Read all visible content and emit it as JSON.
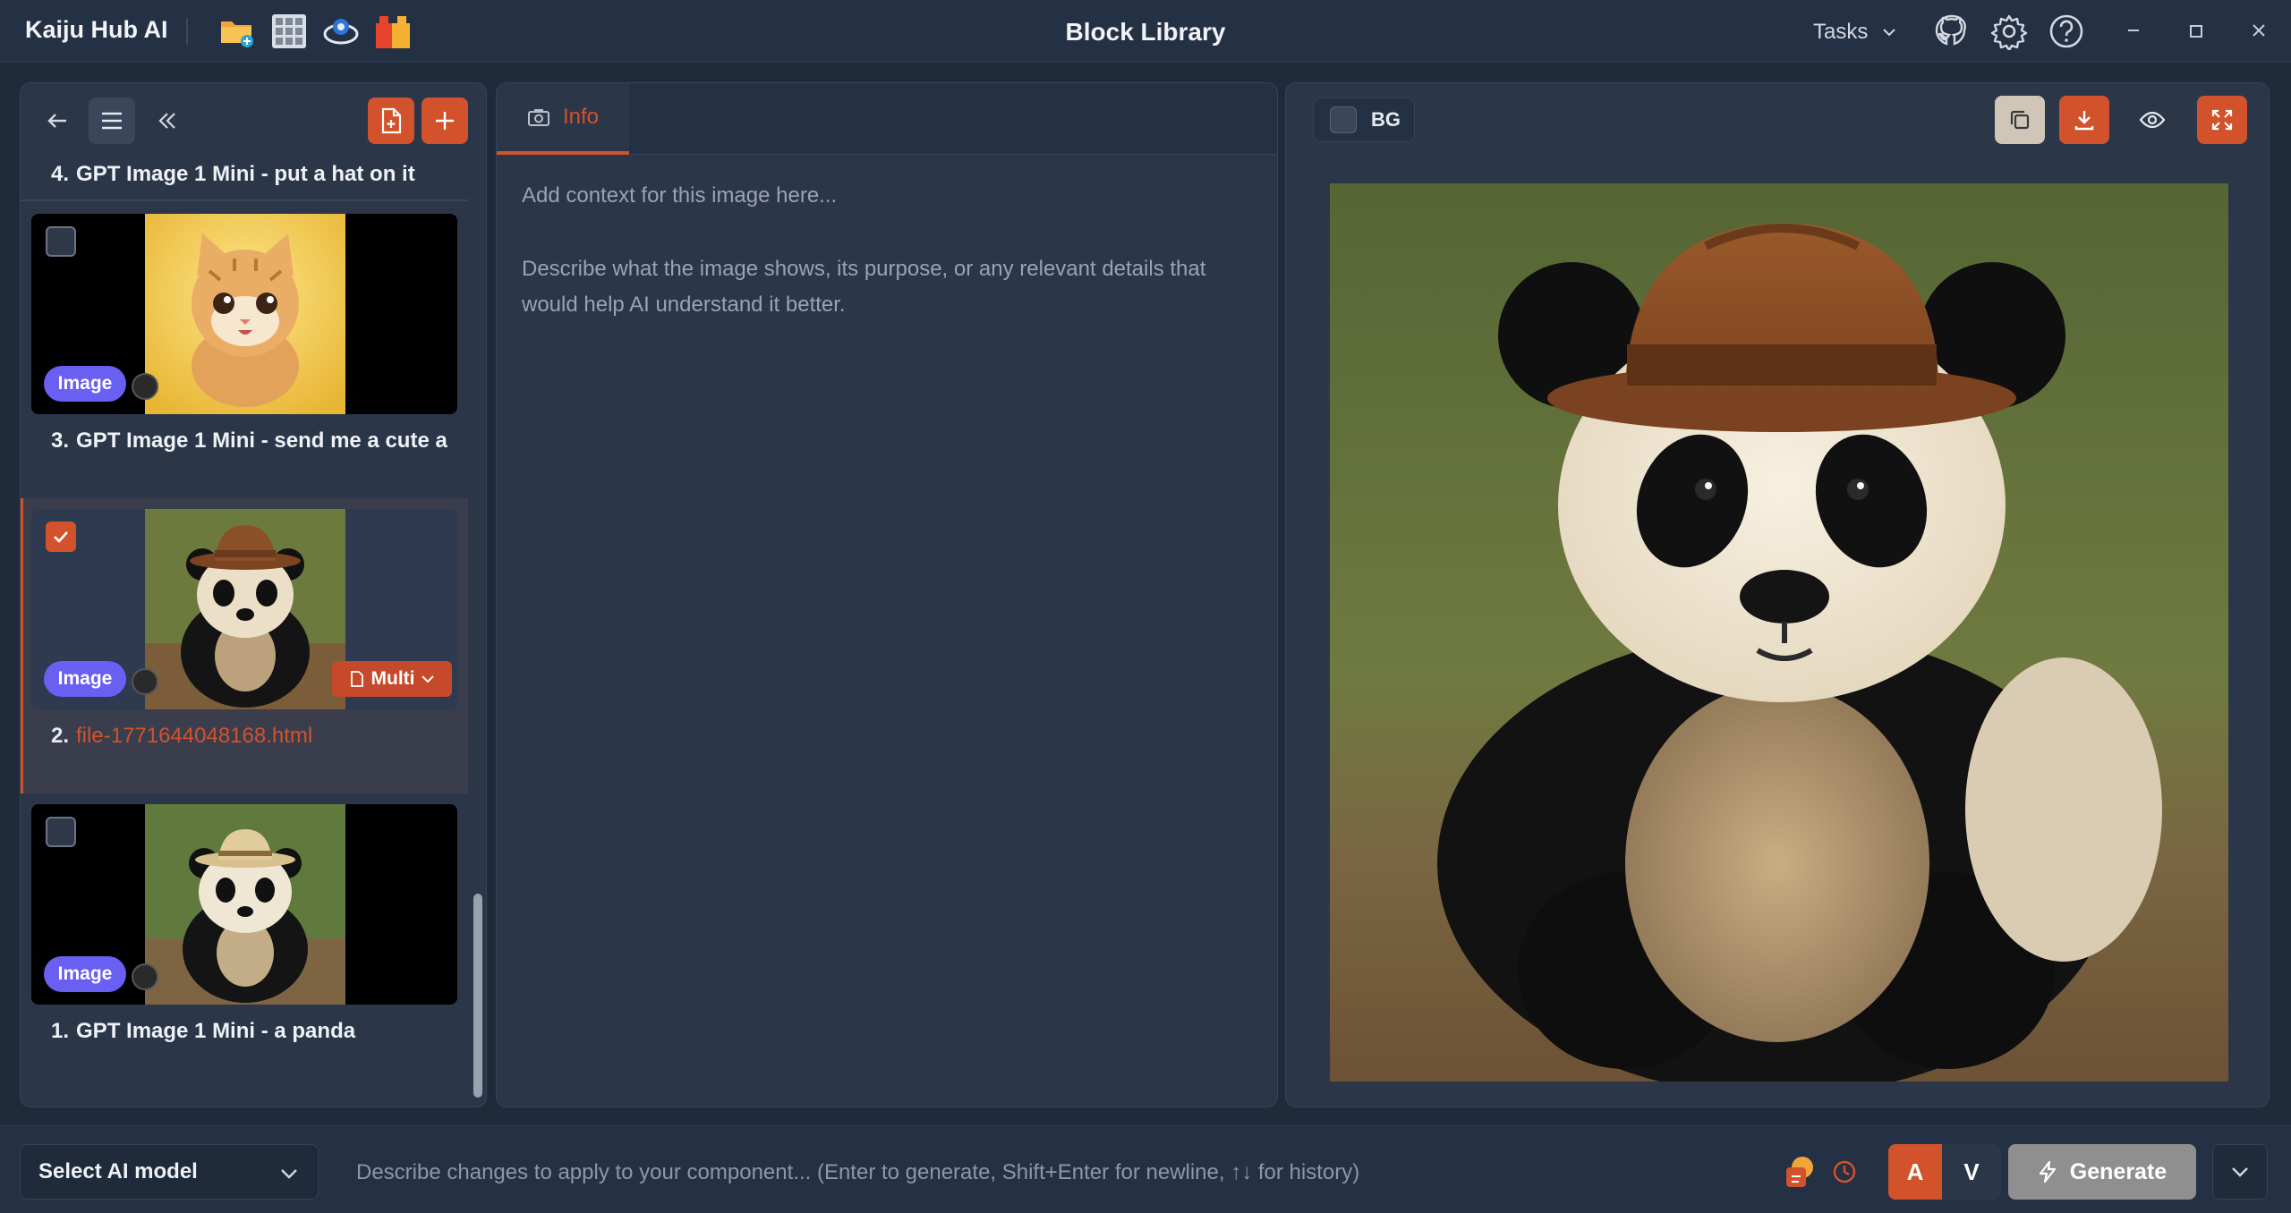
{
  "app": {
    "name": "Kaiju Hub AI",
    "window_title": "Block Library"
  },
  "titlebar": {
    "tasks_label": "Tasks",
    "quick_icons": [
      "folder-add-icon",
      "grid-icon",
      "eye-robot-icon",
      "blocks-icon"
    ],
    "right_icons": [
      "github-icon",
      "gear-icon",
      "help-icon"
    ],
    "window_controls": [
      "minimize-icon",
      "maximize-icon",
      "close-icon"
    ]
  },
  "library": {
    "items": [
      {
        "num": "4.",
        "title": "GPT Image 1 Mini - put a hat on it"
      },
      {
        "num": "3.",
        "title": "GPT Image 1 Mini - send me a cute a",
        "badge": "Image",
        "checked": false
      },
      {
        "num": "2.",
        "title": "file-1771644048168.html",
        "badge": "Image",
        "checked": true,
        "action_label": "Multi"
      },
      {
        "num": "1.",
        "title": "GPT Image 1 Mini - a panda",
        "badge": "Image",
        "checked": false
      }
    ]
  },
  "info_panel": {
    "tab_label": "Info",
    "context_placeholder": "Add context for this image here...",
    "help_text": "Describe what the image shows, its purpose, or any relevant details that would help AI understand it better."
  },
  "preview": {
    "bg_label": "BG"
  },
  "bottombar": {
    "model_select_label": "Select AI model",
    "prompt_placeholder": "Describe changes to apply to your component... (Enter to generate, Shift+Enter for newline, ↑↓ for history)",
    "a_label": "A",
    "v_label": "V",
    "generate_label": "Generate"
  },
  "colors": {
    "accent": "#d2532b",
    "badge": "#6a5ff3",
    "panel": "#2b3649",
    "background": "#1f2a3a"
  }
}
